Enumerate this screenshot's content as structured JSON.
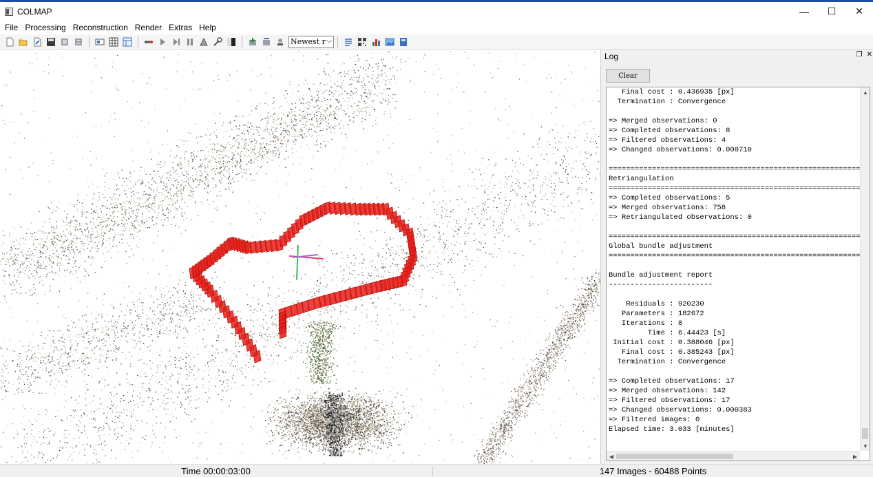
{
  "app": {
    "title": "COLMAP",
    "icon": "app-window-icon"
  },
  "window_controls": {
    "minimize": "—",
    "maximize": "☐",
    "close": "✕"
  },
  "menu": [
    "File",
    "Processing",
    "Reconstruction",
    "Render",
    "Extras",
    "Help"
  ],
  "toolbar": {
    "select_value": "Newest r",
    "icons": [
      "new-project-icon",
      "open-project-icon",
      "edit-project-icon",
      "save-project-icon",
      "import-icon",
      "export-icon",
      "feature-extraction-icon",
      "feature-matching-icon",
      "database-icon",
      "start-reconstruction-icon",
      "play-icon",
      "step-icon",
      "pause-icon",
      "bundle-adjustment-icon",
      "tools-icon",
      "dense-icon",
      "render-options-icon",
      "reset-view-icon",
      "grab-image-icon",
      "log-icon",
      "match-matrix-icon",
      "statistics-icon",
      "screenshot-icon",
      "movie-icon"
    ]
  },
  "log": {
    "title": "Log",
    "clear_label": "Clear",
    "lines": [
      "   Final cost : 0.436935 [px]",
      "  Termination : Convergence",
      "",
      "=> Merged observations: 0",
      "=> Completed observations: 8",
      "=> Filtered observations: 4",
      "=> Changed observations: 0.000710",
      "",
      "==============================================================================",
      "Retriangulation",
      "==============================================================================",
      "=> Completed observations: 5",
      "=> Merged observations: 758",
      "=> Retriangulated observations: 0",
      "",
      "==============================================================================",
      "Global bundle adjustment",
      "==============================================================================",
      "",
      "Bundle adjustment report",
      "------------------------",
      "",
      "    Residuals : 920230",
      "   Parameters : 182672",
      "   Iterations : 8",
      "         Time : 6.44423 [s]",
      " Initial cost : 0.388046 [px]",
      "   Final cost : 0.385243 [px]",
      "  Termination : Convergence",
      "",
      "=> Completed observations: 17",
      "=> Merged observations: 142",
      "=> Filtered observations: 17",
      "=> Changed observations: 0.000383",
      "=> Filtered images: 0",
      "Elapsed time: 3.033 [minutes]"
    ]
  },
  "status": {
    "time": "Time 00:00:03:00",
    "summary": "147 Images - 60488 Points"
  },
  "colors": {
    "camera": "#e8211b",
    "title_accent": "#1e4f9c",
    "axis_x": "#e0457a",
    "axis_y": "#3cc04c",
    "axis_z": "#9a6fd8"
  }
}
